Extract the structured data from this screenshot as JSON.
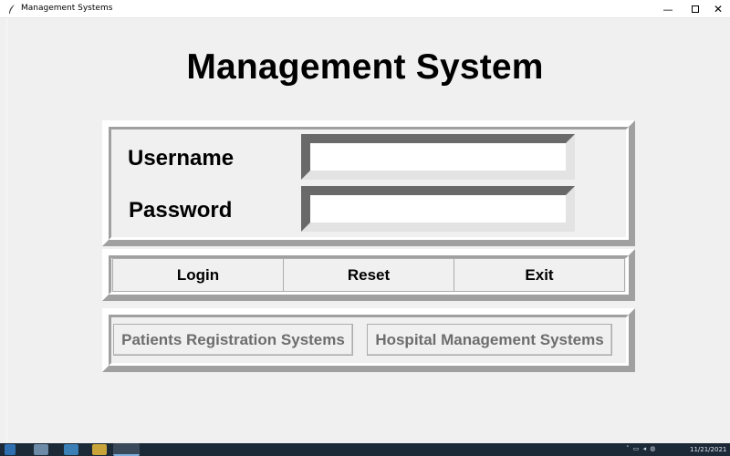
{
  "window": {
    "title": "Management Systems",
    "app_icon": "feather-icon",
    "minimize_glyph": "—",
    "close_glyph": "✕"
  },
  "page": {
    "heading": "Management System"
  },
  "login_form": {
    "username_label": "Username",
    "password_label": "Password",
    "username_value": "",
    "password_value": ""
  },
  "buttons": {
    "login": "Login",
    "reset": "Reset",
    "exit": "Exit"
  },
  "systems": {
    "patients": "Patients Registration Systems",
    "hospital": "Hospital Management Systems",
    "enabled": false
  },
  "taskbar": {
    "date": "11/21/2021",
    "tray_icons": "˄ ▭ ◂ ◍"
  },
  "colors": {
    "background": "#f0f0f0",
    "frame_dark": "#a0a0a0",
    "frame_light": "#ffffff",
    "disabled_text": "#6d6d6d",
    "taskbar": "#1c2a38"
  }
}
